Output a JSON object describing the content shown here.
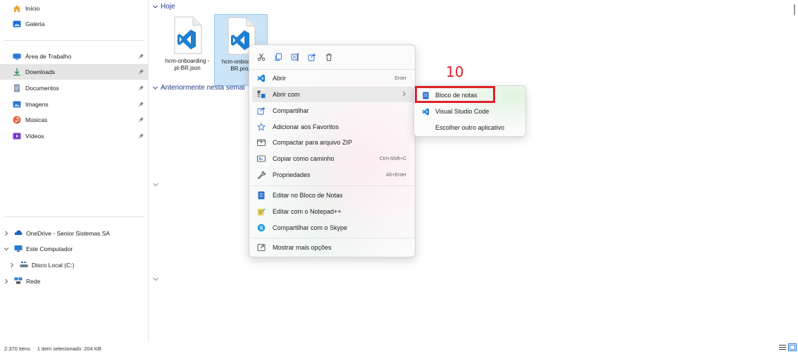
{
  "nav": {
    "quick": [
      {
        "label": "Início",
        "icon": "home-icon"
      },
      {
        "label": "Galeria",
        "icon": "gallery-icon"
      }
    ],
    "pinned": [
      {
        "label": "Área de Trabalho",
        "icon": "desktop-icon"
      },
      {
        "label": "Downloads",
        "icon": "downloads-icon",
        "selected": true
      },
      {
        "label": "Documentos",
        "icon": "documents-icon"
      },
      {
        "label": "Imagens",
        "icon": "pictures-icon"
      },
      {
        "label": "Músicas",
        "icon": "music-icon"
      },
      {
        "label": "Vídeos",
        "icon": "videos-icon"
      }
    ],
    "tree": [
      {
        "label": "OneDrive - Senior Sistemas SA",
        "icon": "onedrive-icon",
        "chevron": "right"
      },
      {
        "label": "Este Computador",
        "icon": "computer-icon",
        "chevron": "down"
      },
      {
        "label": "Disco Local (C:)",
        "icon": "drive-icon",
        "chevron": "right"
      },
      {
        "label": "Rede",
        "icon": "network-icon",
        "chevron": "right"
      }
    ]
  },
  "main": {
    "group_today": "Hoje",
    "group_earlier": "Anteriormente nesta semai",
    "files": [
      {
        "name": "hcm-onboarding -pt-BR.json",
        "selected": false
      },
      {
        "name": "hcm-onboa -pt-BR.prop",
        "selected": true
      }
    ]
  },
  "context_menu": {
    "toolbar": [
      "cut-icon",
      "copy-icon",
      "rename-icon",
      "share-icon",
      "delete-icon"
    ],
    "items": [
      {
        "label": "Abrir",
        "icon": "vscode-icon",
        "shortcut": "Enter"
      },
      {
        "label": "Abrir com",
        "icon": "open-with-icon",
        "shortcut": "",
        "submenu": true
      },
      {
        "label": "Compartilhar",
        "icon": "share-icon",
        "shortcut": ""
      },
      {
        "label": "Adicionar aos Favoritos",
        "icon": "star-icon",
        "shortcut": ""
      },
      {
        "label": "Compactar para arquivo ZIP",
        "icon": "zip-icon",
        "shortcut": ""
      },
      {
        "label": "Copiar como caminho",
        "icon": "path-icon",
        "shortcut": "Ctrl+Shift+C"
      },
      {
        "label": "Propriedades",
        "icon": "properties-icon",
        "shortcut": "Alt+Enter"
      },
      {
        "label": "Editar no Bloco de Notas",
        "icon": "notepad-icon",
        "shortcut": ""
      },
      {
        "label": "Editar com o Notepad++",
        "icon": "notepadpp-icon",
        "shortcut": ""
      },
      {
        "label": "Compartilhar com o Skype",
        "icon": "skype-icon",
        "shortcut": ""
      },
      {
        "label": "Mostrar mais opções",
        "icon": "more-options-icon",
        "shortcut": ""
      }
    ]
  },
  "submenu": {
    "items": [
      {
        "label": "Bloco de notas",
        "icon": "notepad-icon"
      },
      {
        "label": "Visual Studio Code",
        "icon": "vscode-icon"
      },
      {
        "label": "Escolher outro aplicativo",
        "icon": ""
      }
    ]
  },
  "annotation": {
    "step": "10",
    "color": "#e0202a"
  },
  "status": {
    "count": "2.370 itens",
    "selection": "1 item selecionado",
    "size": "204 KB"
  },
  "colors": {
    "accent": "#0078d4",
    "vscode": "#1f7fd0",
    "highlight": "#e0202a"
  }
}
